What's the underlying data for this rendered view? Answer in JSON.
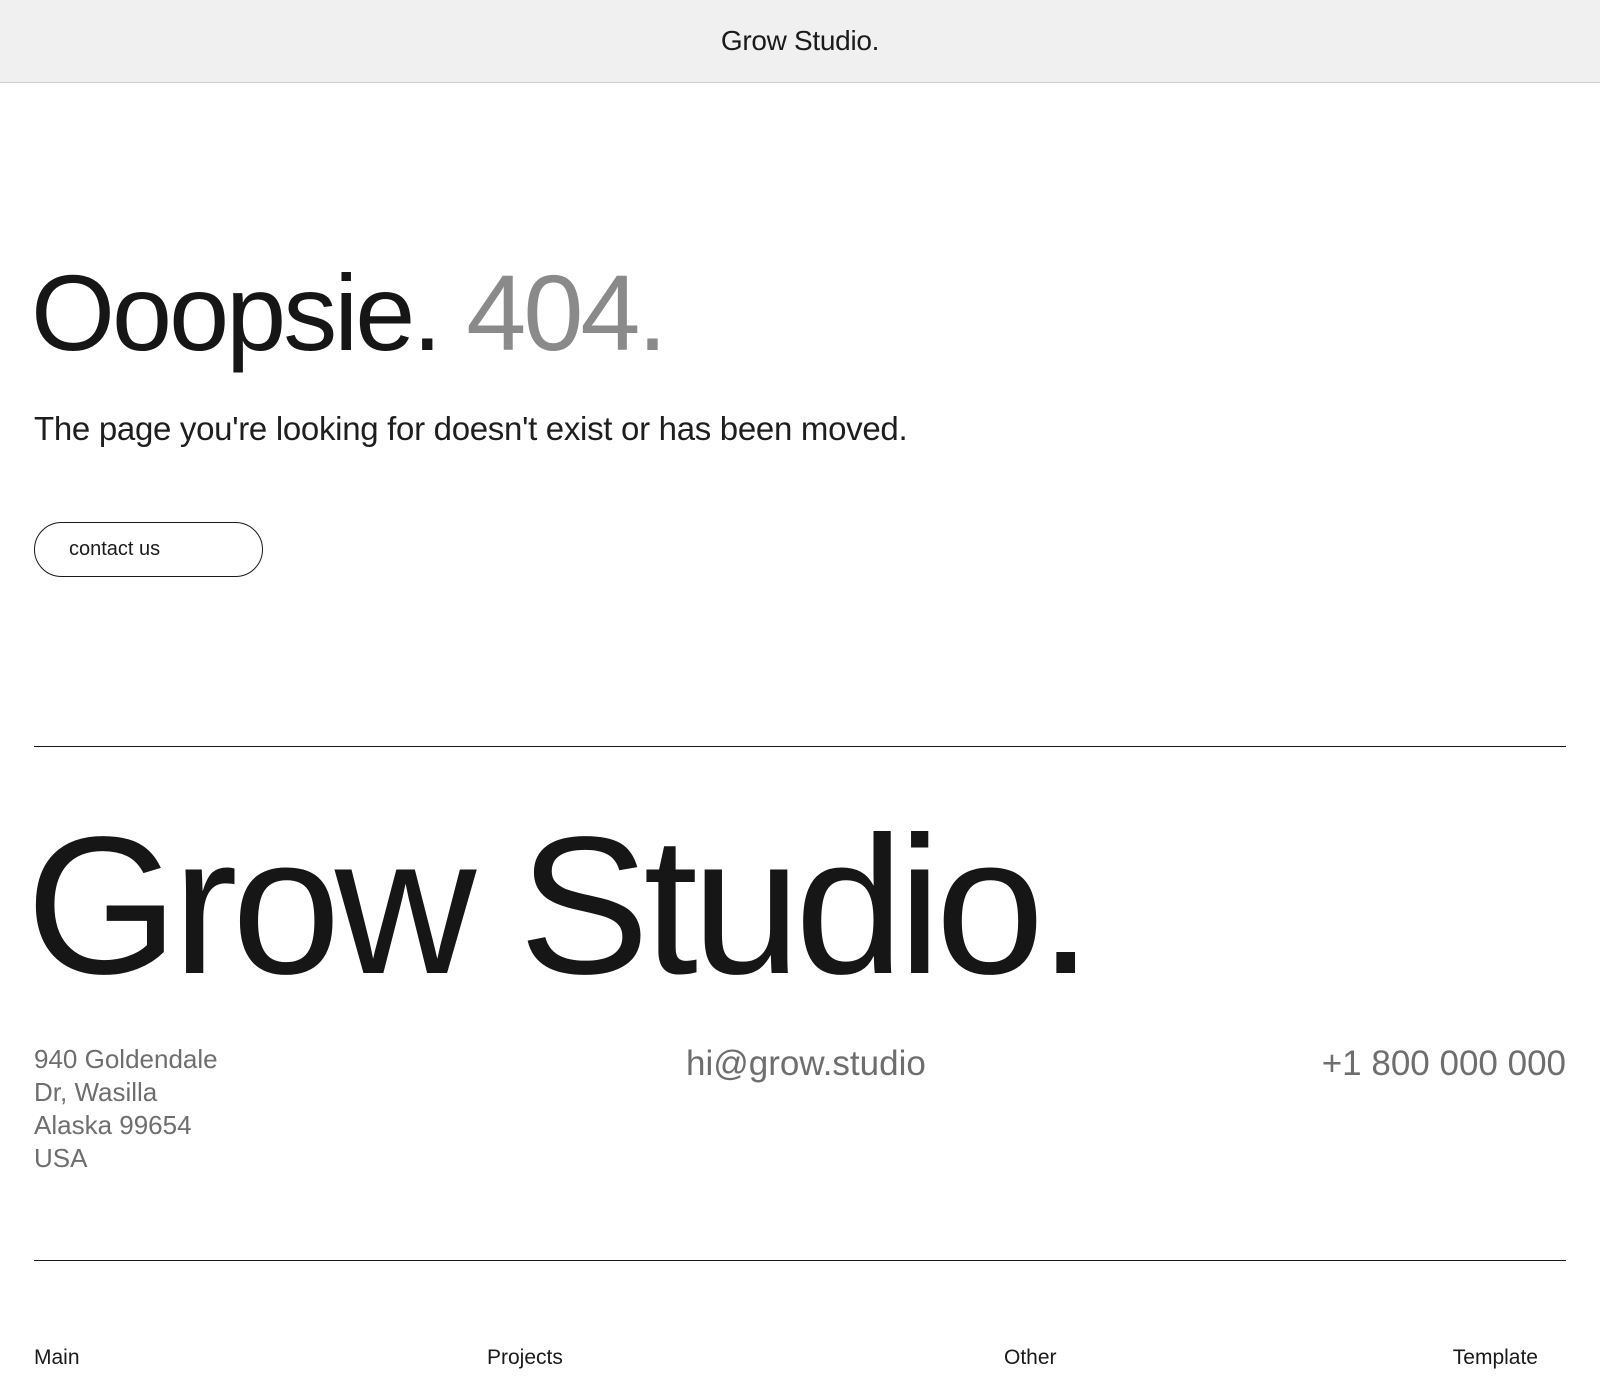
{
  "header": {
    "title": "Grow Studio."
  },
  "hero": {
    "title_main": "Ooopsie.",
    "title_code": "404.",
    "subtitle": "The page you're looking for doesn't exist or has been moved.",
    "contact_label": "contact us"
  },
  "footer": {
    "brand": "Grow Studio.",
    "address": {
      "line1": "940 Goldendale",
      "line2": "Dr, Wasilla",
      "line3": "Alaska 99654",
      "line4": "USA"
    },
    "email": "hi@grow.studio",
    "phone": "+1 800 000 000",
    "nav": {
      "main": "Main",
      "projects": "Projects",
      "other": "Other",
      "template": "Template"
    }
  },
  "colors": {
    "topbar_bg": "#f0f0f0",
    "text_dark": "#161616",
    "text_muted": "#6e6e6e",
    "code_gray": "#8a8a8a"
  }
}
